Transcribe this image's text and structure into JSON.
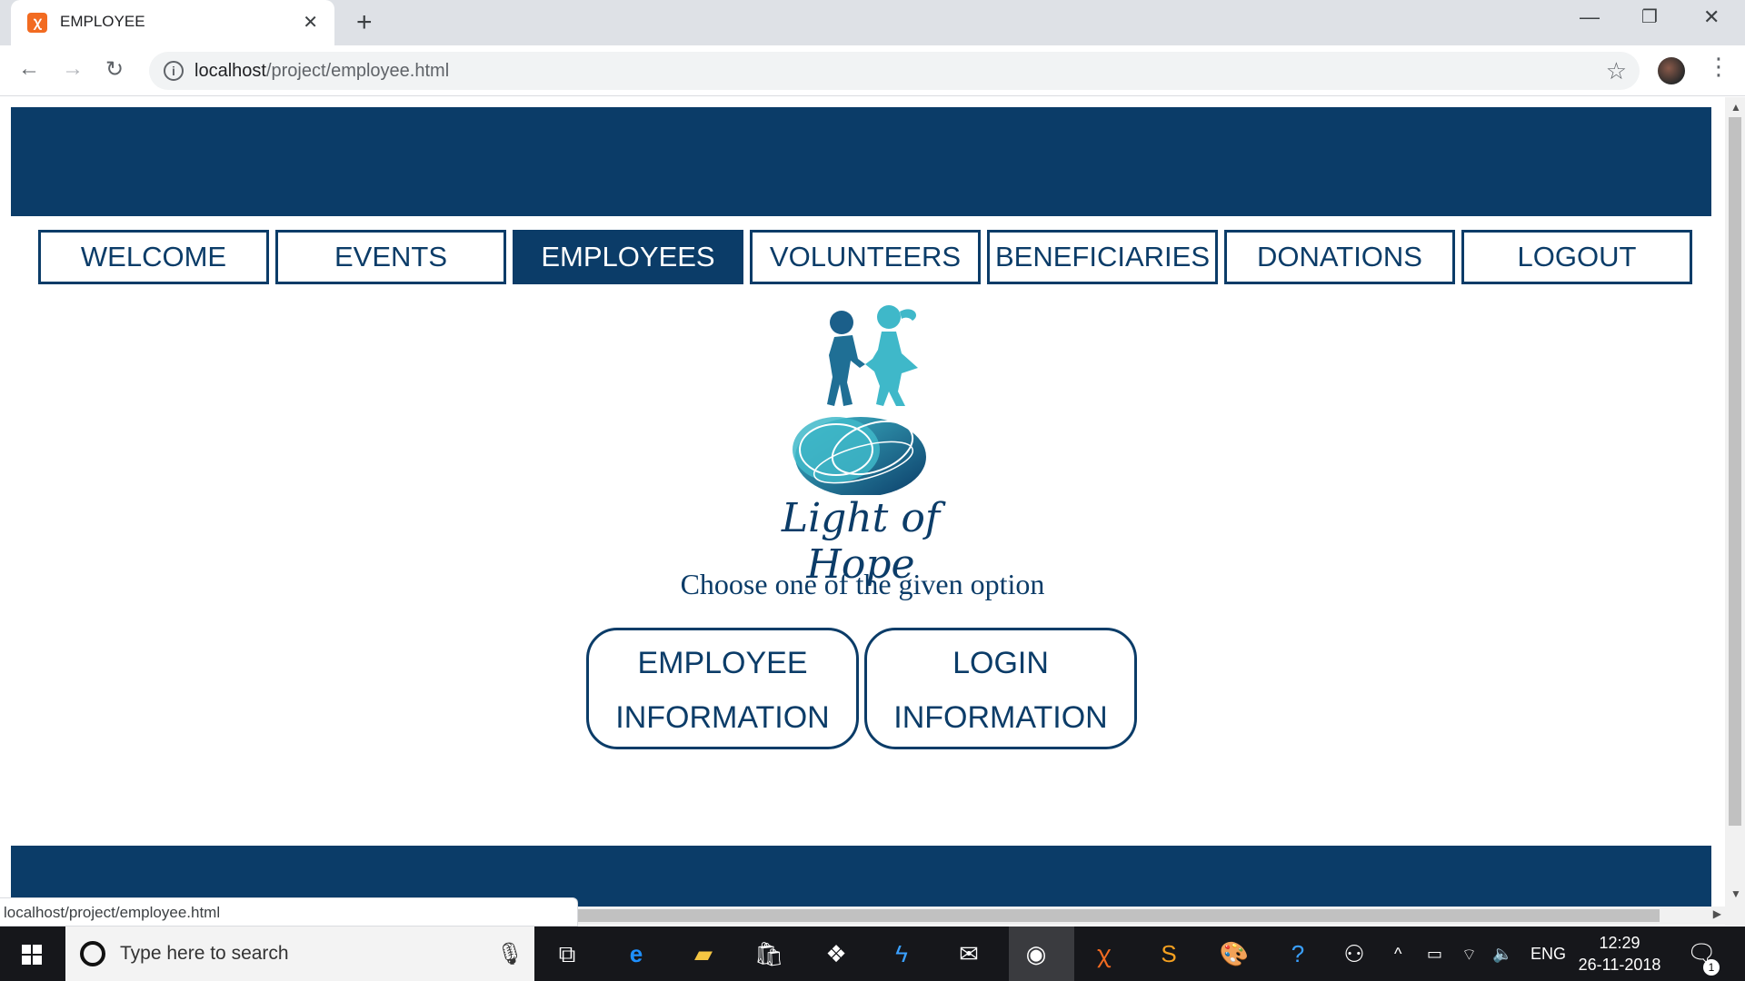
{
  "browser": {
    "tab_title": "EMPLOYEE",
    "tab_icon": "xampp-icon",
    "url_host": "localhost",
    "url_path": "/project/employee.html",
    "status_url": "localhost/project/employee.html"
  },
  "page": {
    "nav": [
      {
        "label": "WELCOME",
        "active": false
      },
      {
        "label": "EVENTS",
        "active": false
      },
      {
        "label": "EMPLOYEES",
        "active": true
      },
      {
        "label": "VOLUNTEERS",
        "active": false
      },
      {
        "label": "BENEFICIARIES",
        "active": false
      },
      {
        "label": "DONATIONS",
        "active": false
      },
      {
        "label": "LOGOUT",
        "active": false
      }
    ],
    "logo_text": "Light of Hope",
    "subtitle": "Choose one of the given option",
    "options": [
      {
        "line1": "EMPLOYEE",
        "line2": "INFORMATION"
      },
      {
        "line1": "LOGIN",
        "line2": "INFORMATION"
      }
    ],
    "colors": {
      "primary": "#0b3c68",
      "logo_teal": "#3fb8c9"
    }
  },
  "taskbar": {
    "search_placeholder": "Type here to search",
    "language": "ENG",
    "time": "12:29",
    "date": "26-11-2018",
    "notification_count": "1"
  }
}
